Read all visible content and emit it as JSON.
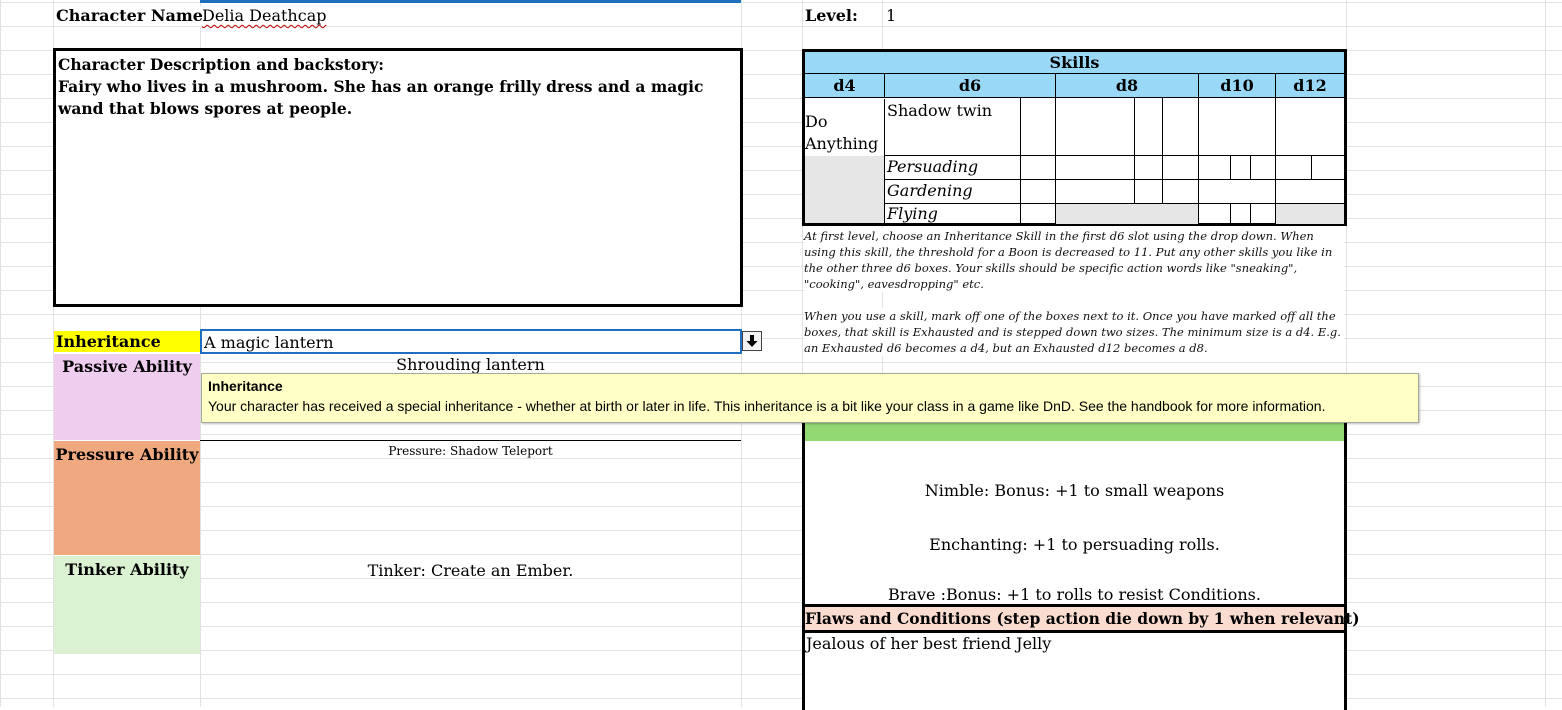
{
  "character": {
    "name_label": "Character Name:",
    "name_value": "Delia Deathcap",
    "level_label": "Level:",
    "level_value": "1"
  },
  "description": {
    "heading": "Character Description and backstory:",
    "body": "Fairy who lives in a mushroom. She has an orange frilly dress and a magic wand that blows spores at people."
  },
  "skills": {
    "title": "Skills",
    "dice": [
      "d4",
      "d6",
      "d8",
      "d10",
      "d12"
    ],
    "d4_skill": "Do Anything",
    "d6_skills": [
      "Shadow twin",
      "Persuading",
      "Gardening",
      "Flying"
    ],
    "note1": "At first level, choose an Inheritance Skill in the first d6 slot using the drop down. When using this skill, the threshold for a Boon is decreased to 11. Put any other skills you like in the other three d6 boxes. Your skills should be specific action words like \"sneaking\", \"cooking\", eavesdropping\" etc.",
    "note2": "When you use a skill, mark off one of the boxes next to it. Once you have marked off all the boxes, that skill is Exhausted and is stepped down two sizes. The minimum size is a d4. E.g. an Exhausted d6 becomes a d4, but an Exhausted d12 becomes a d8."
  },
  "inheritance": {
    "label": "Inheritance",
    "value": "A magic lantern",
    "dropdown_icon": "dropdown-arrow-icon"
  },
  "abilities": {
    "passive_label": "Passive Ability",
    "passive_value": "Shrouding lantern",
    "pressure_label": "Pressure Ability",
    "pressure_value": "Pressure: Shadow Teleport",
    "tinker_label": "Tinker Ability",
    "tinker_value": "Tinker: Create an Ember."
  },
  "traits": {
    "items": [
      "Nimble: Bonus: +1 to small weapons",
      "Enchanting:  +1 to persuading rolls.",
      "Brave :Bonus: +1 to rolls to resist Conditions."
    ]
  },
  "flaws": {
    "heading": "Flaws and Conditions (step action die down by 1 when relevant)",
    "body": "Jealous of her best friend Jelly"
  },
  "tooltip": {
    "title": "Inheritance",
    "body": "Your character has received a special inheritance - whether at birth or later in life. This inheritance is a bit like your class in a game like DnD. See the handbook for more information."
  },
  "colors": {
    "skills_header": "#99d9f7",
    "inheritance_yellow": "#ffff00",
    "passive_pink": "#efcdee",
    "pressure_orange": "#f0a97f",
    "tinker_green": "#daf1d2",
    "traits_green": "#92d873",
    "flaws_peach": "#fbdcd0",
    "grey_fill": "#e6e6e6",
    "tooltip_bg": "#ffffc6"
  }
}
